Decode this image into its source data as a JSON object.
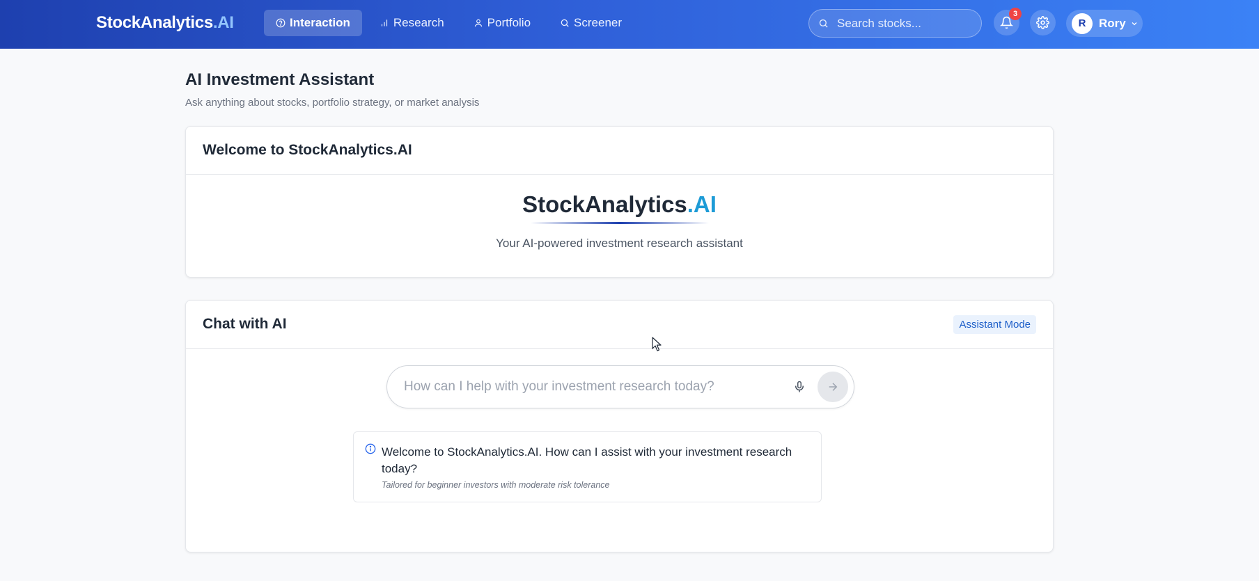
{
  "app": {
    "logo_main": "StockAnalytics",
    "logo_suffix": ".AI"
  },
  "nav": {
    "items": [
      {
        "label": "Interaction",
        "icon": "help-circle-icon",
        "active": true
      },
      {
        "label": "Research",
        "icon": "bar-chart-icon",
        "active": false
      },
      {
        "label": "Portfolio",
        "icon": "user-icon",
        "active": false
      },
      {
        "label": "Screener",
        "icon": "search-icon",
        "active": false
      }
    ]
  },
  "header": {
    "search_placeholder": "Search stocks...",
    "notification_count": "3",
    "user_initial": "R",
    "user_name": "Rory"
  },
  "page": {
    "title": "AI Investment Assistant",
    "subtitle": "Ask anything about stocks, portfolio strategy, or market analysis"
  },
  "welcome_card": {
    "title": "Welcome to StockAnalytics.AI",
    "brand_main": "StockAnalytics",
    "brand_suffix": ".AI",
    "tagline": "Your AI-powered investment research assistant"
  },
  "chat_card": {
    "title": "Chat with AI",
    "mode_badge": "Assistant Mode",
    "input_placeholder": "How can I help with your investment research today?",
    "message_text": "Welcome to StockAnalytics.AI. How can I assist with your investment research today?",
    "message_note": "Tailored for beginner investors with moderate risk tolerance"
  },
  "colors": {
    "nav_gradient_start": "#1e40af",
    "nav_gradient_end": "#3b82f6",
    "accent": "#1d9bd6",
    "badge": "#ef4444"
  }
}
